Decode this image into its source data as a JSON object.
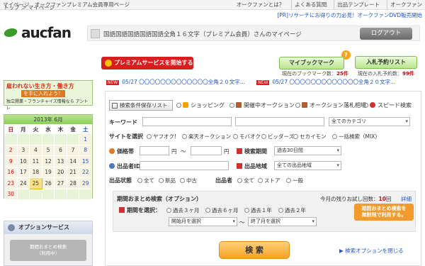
{
  "topbar": {
    "left": "マイページ　オークファンプレミアム会員専用ページ",
    "links": [
      "オークファンとは？",
      "よくある質問",
      "出品テンプレート",
      "オークファン"
    ]
  },
  "header": {
    "logo_text": "aucfan",
    "promo": "[PR]リサーチにお得りの力必見！オークファンDVD販売開始",
    "username_line": "国語国語国語国語国語全角１６文字（プレミアム会員）さんのマイページ",
    "logout": "ログアウト"
  },
  "breadcrumb": "トップ ＞ マイページ",
  "premium_button": "プレミアムサービスを開始する",
  "bookmark": {
    "label": "マイブックマーク",
    "count_text": "現在のブックマーク数：",
    "count": "25件"
  },
  "bid_list": {
    "label": "入札予約リスト",
    "count_text": "現在の入札予約数：",
    "count": "99件"
  },
  "news": [
    {
      "tag": "NEW",
      "text": "05/27 〇〇〇〇〇〇〇〇〇〇〇〇〇全角２０文字..."
    },
    {
      "tag": "NEW",
      "text": "05/27 〇〇〇〇〇〇〇〇〇〇〇〇〇全角２０文字..."
    }
  ],
  "ad": {
    "line1": "雇われない生き方・働き方",
    "line2": "を手に入れよう！",
    "line3": "独立開業・フランチャイズ情報なら アントレ"
  },
  "calendar": {
    "title": "2013年 6月",
    "dow": [
      "日",
      "月",
      "火",
      "水",
      "木",
      "金",
      "土"
    ],
    "weeks": [
      [
        "",
        "",
        "",
        "",
        "",
        "",
        "1"
      ],
      [
        "2",
        "3",
        "4",
        "5",
        "6",
        "7",
        "8"
      ],
      [
        "9",
        "10",
        "11",
        "12",
        "13",
        "14",
        "15"
      ],
      [
        "16",
        "17",
        "18",
        "19",
        "20",
        "21",
        "22"
      ],
      [
        "23",
        "24",
        "25",
        "26",
        "27",
        "28",
        "29"
      ],
      [
        "30",
        "",
        "",
        "",
        "",
        "",
        ""
      ]
    ],
    "today": "25"
  },
  "option_service": {
    "title": "オプションサービス",
    "button": "期間おまとめ検索\n（利用中）"
  },
  "search": {
    "save_list": "検索条件保存リスト",
    "tabs": [
      "ショッピング",
      "開催中オークション",
      "オークション落札相場",
      "スピード検索"
    ],
    "keyword_label": "キーワード",
    "category_select": "全てのカテゴリ",
    "site_label": "サイトを選択",
    "sites": [
      "ヤフオク!",
      "楽天オークション",
      "モバオク",
      "ビッダーズ",
      "セカイモン",
      "一括検索（MIX)"
    ],
    "price_label": "価格帯",
    "yen": "円",
    "tilde": "〜",
    "period_label": "検索期間",
    "period_select": "過去30日間",
    "seller_id_label": "出品者ID",
    "region_label": "出品地域",
    "region_select": "全ての出品地域",
    "condition_label": "出品状態",
    "conditions": [
      "全て",
      "新品",
      "中古"
    ],
    "seller_label": "出品者",
    "sellers": [
      "全て",
      "ストア",
      "一般"
    ],
    "option_title": "期間おまとめ検索（オプション）",
    "remaining_text": "今月の残りお試し回数：",
    "remaining_count": "10",
    "remaining_unit": "回",
    "detail_link": "詳細",
    "period_choose_label": "期間を選択：",
    "periods": [
      "過去３ヶ月",
      "過去６ヶ月",
      "過去１年",
      "過去２年"
    ],
    "start_month": "開始月を選択",
    "range_tilde": "〜",
    "end_month": "終了月を選択",
    "orange_btn": "期間おまとめ検索を\n無制限で利用する。",
    "search_button": "検 索",
    "close_link": "検索オプションを閉じる"
  }
}
